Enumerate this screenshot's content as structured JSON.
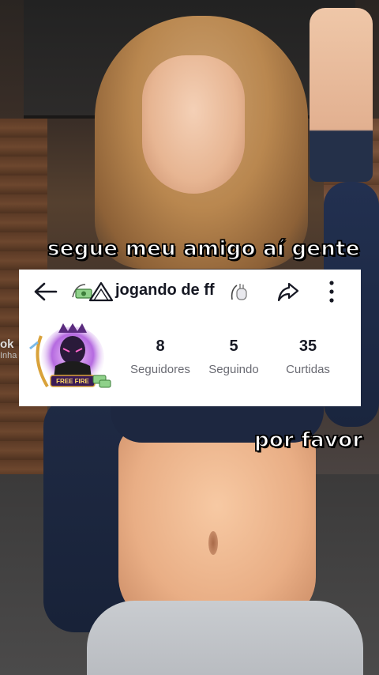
{
  "captions": {
    "top": "segue meu amigo aí gente",
    "bottom": "por favor"
  },
  "side_peek": {
    "main": "ok",
    "sub": "Inha"
  },
  "profile_card": {
    "username": "jogando de ff",
    "avatar_badge": "FREE FIRE",
    "stats": [
      {
        "value": "8",
        "label": "Seguidores"
      },
      {
        "value": "5",
        "label": "Seguindo"
      },
      {
        "value": "35",
        "label": "Curtidas"
      }
    ],
    "icons": [
      "back-arrow-icon",
      "money-emoji-icon",
      "triangle-emoji-icon",
      "hand-emoji-icon",
      "share-icon",
      "more-vertical-icon"
    ]
  },
  "colors": {
    "caption_text": "#ffffff",
    "caption_stroke": "#000000",
    "card_bg": "#ffffff",
    "primary_text": "#161823",
    "secondary_text": "#6a6b73"
  }
}
